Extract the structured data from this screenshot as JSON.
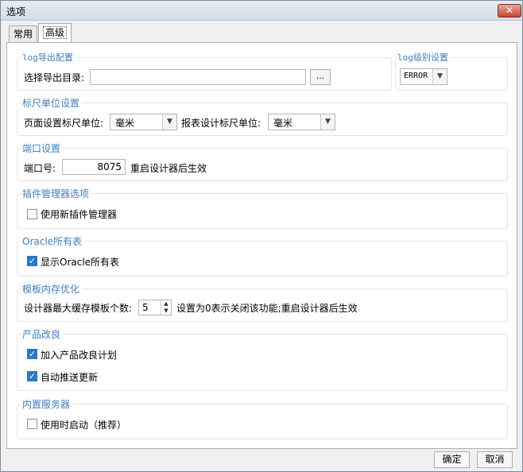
{
  "window": {
    "title": "选项",
    "close": "✕"
  },
  "tabs": [
    {
      "label": "常用"
    },
    {
      "label": "高级"
    }
  ],
  "log_export": {
    "title": "log导出配置",
    "dir_label": "选择导出目录:",
    "dir_value": "",
    "browse": "..."
  },
  "log_level": {
    "title": "log级别设置",
    "value": "ERROR"
  },
  "ruler": {
    "title": "标尺单位设置",
    "page_label": "页面设置标尺单位:",
    "page_value": "毫米",
    "report_label": "报表设计标尺单位:",
    "report_value": "毫米"
  },
  "port": {
    "title": "端口设置",
    "label": "端口号:",
    "value": "8075",
    "note": "重启设计器后生效"
  },
  "plugin": {
    "title": "插件管理器选项",
    "option": "使用新插件管理器",
    "checked": false
  },
  "oracle": {
    "title": "Oracle所有表",
    "option": "显示Oracle所有表",
    "checked": true
  },
  "memory": {
    "title": "模板内存优化",
    "label": "设计器最大缓存模板个数:",
    "value": "5",
    "note": "设置为0表示关闭该功能;重启设计器后生效"
  },
  "improve": {
    "title": "产品改良",
    "opt1": "加入产品改良计划",
    "opt1_checked": true,
    "opt2": "自动推送更新",
    "opt2_checked": true
  },
  "server": {
    "title": "内置服务器",
    "option": "使用时启动（推荐）",
    "checked": false
  },
  "footer": {
    "ok": "确定",
    "cancel": "取消"
  },
  "icons": {
    "check": "✓",
    "dropdown": "▼",
    "spin_up": "▲",
    "spin_down": "▼"
  }
}
